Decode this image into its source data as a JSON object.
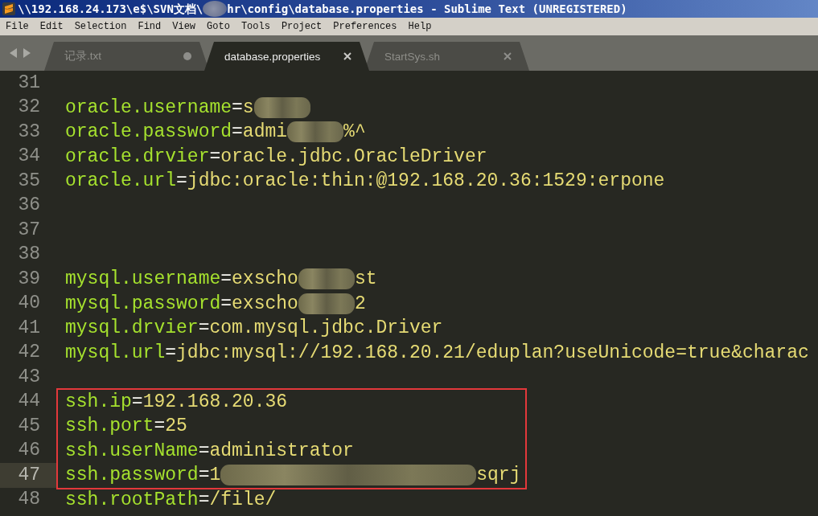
{
  "window": {
    "title": [
      {
        "kind": "text",
        "text": "\\\\192.168.24.173\\e$\\SVN文档\\"
      },
      {
        "kind": "blur"
      },
      {
        "kind": "text",
        "text": "hr\\config\\database.properties - Sublime Text (UNREGISTERED)"
      }
    ]
  },
  "menu": [
    "File",
    "Edit",
    "Selection",
    "Find",
    "View",
    "Goto",
    "Tools",
    "Project",
    "Preferences",
    "Help"
  ],
  "tabs": [
    {
      "label": "记录.txt",
      "selected": false,
      "modified": true
    },
    {
      "label": "database.properties",
      "selected": true,
      "modified": false
    },
    {
      "label": "StartSys.sh",
      "selected": false,
      "modified": false
    }
  ],
  "editor": {
    "blocks": [
      {
        "kind": "line",
        "number": "31",
        "current": false
      },
      {
        "kind": "line",
        "number": "32",
        "current": false,
        "segments": [
          {
            "kind": "key",
            "text": "oracle.username"
          },
          {
            "kind": "op",
            "text": "="
          },
          {
            "kind": "value",
            "text": "s"
          },
          {
            "kind": "blur"
          }
        ]
      },
      {
        "kind": "line",
        "number": "33",
        "current": false,
        "segments": [
          {
            "kind": "key",
            "text": "oracle.password"
          },
          {
            "kind": "op",
            "text": "="
          },
          {
            "kind": "value",
            "text": "admi"
          },
          {
            "kind": "blur"
          },
          {
            "kind": "value",
            "text": "%^"
          }
        ]
      },
      {
        "kind": "line",
        "number": "34",
        "current": false,
        "segments": [
          {
            "kind": "key",
            "text": "oracle.drvier"
          },
          {
            "kind": "op",
            "text": "="
          },
          {
            "kind": "value",
            "text": "oracle.jdbc.OracleDriver"
          }
        ]
      },
      {
        "kind": "line",
        "number": "35",
        "current": false,
        "segments": [
          {
            "kind": "key",
            "text": "oracle.url"
          },
          {
            "kind": "op",
            "text": "="
          },
          {
            "kind": "value",
            "text": "jdbc:oracle:thin:@192.168.20.36:1529:erpone"
          }
        ]
      },
      {
        "kind": "line",
        "number": "36",
        "current": false
      },
      {
        "kind": "line",
        "number": "37",
        "current": false
      },
      {
        "kind": "line",
        "number": "38",
        "current": false
      },
      {
        "kind": "line",
        "number": "39",
        "current": false,
        "segments": [
          {
            "kind": "key",
            "text": "mysql.username"
          },
          {
            "kind": "op",
            "text": "="
          },
          {
            "kind": "value",
            "text": "exscho"
          },
          {
            "kind": "blur"
          },
          {
            "kind": "value",
            "text": "st"
          }
        ]
      },
      {
        "kind": "line",
        "number": "40",
        "current": false,
        "segments": [
          {
            "kind": "key",
            "text": "mysql.password"
          },
          {
            "kind": "op",
            "text": "="
          },
          {
            "kind": "value",
            "text": "exscho"
          },
          {
            "kind": "blur"
          },
          {
            "kind": "value",
            "text": "2"
          }
        ]
      },
      {
        "kind": "line",
        "number": "41",
        "current": false,
        "segments": [
          {
            "kind": "key",
            "text": "mysql.drvier"
          },
          {
            "kind": "op",
            "text": "="
          },
          {
            "kind": "value",
            "text": "com.mysql.jdbc.Driver"
          }
        ]
      },
      {
        "kind": "line",
        "number": "42",
        "current": false,
        "segments": [
          {
            "kind": "key",
            "text": "mysql.url"
          },
          {
            "kind": "op",
            "text": "="
          },
          {
            "kind": "value",
            "text": "jdbc:mysql://192.168.20.21/eduplan?useUnicode=true&charac"
          }
        ]
      },
      {
        "kind": "line",
        "number": "43",
        "current": false
      },
      {
        "kind": "box",
        "lines": [
          {
            "number": "44",
            "current": false,
            "segments": [
              {
                "kind": "key",
                "text": "ssh.ip"
              },
              {
                "kind": "op",
                "text": "="
              },
              {
                "kind": "value",
                "text": "192.168.20.36"
              }
            ]
          },
          {
            "number": "45",
            "current": false,
            "segments": [
              {
                "kind": "key",
                "text": "ssh.port"
              },
              {
                "kind": "op",
                "text": "="
              },
              {
                "kind": "value",
                "text": "25"
              }
            ]
          },
          {
            "number": "46",
            "current": false,
            "segments": [
              {
                "kind": "key",
                "text": "ssh.userName"
              },
              {
                "kind": "op",
                "text": "="
              },
              {
                "kind": "value",
                "text": "administrator"
              }
            ]
          },
          {
            "number": "47",
            "current": true,
            "segments": [
              {
                "kind": "key",
                "text": "ssh.password"
              },
              {
                "kind": "op",
                "text": "="
              },
              {
                "kind": "value",
                "text": "1"
              },
              {
                "kind": "long-blur"
              },
              {
                "kind": "value",
                "text": "sqrj"
              }
            ]
          }
        ]
      },
      {
        "kind": "line",
        "number": "48",
        "current": false,
        "segments": [
          {
            "kind": "key",
            "text": "ssh.rootPath"
          },
          {
            "kind": "op",
            "text": "="
          },
          {
            "kind": "value",
            "text": "/file/"
          }
        ]
      }
    ]
  }
}
